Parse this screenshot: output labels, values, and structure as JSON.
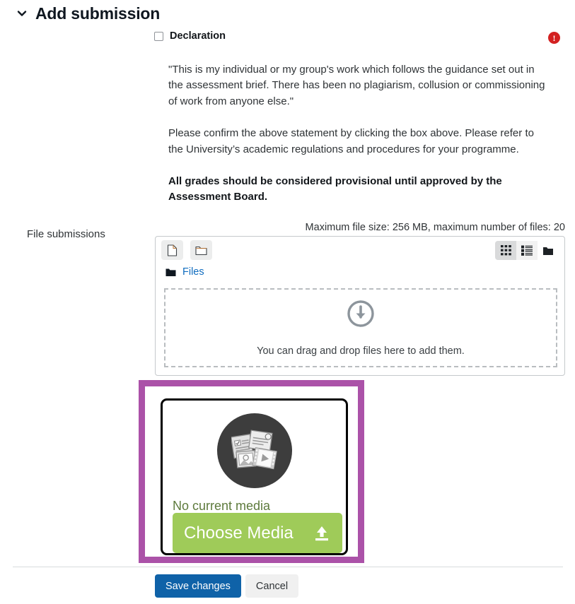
{
  "section": {
    "title": "Add submission",
    "toggle_icon": "chevron-down-icon"
  },
  "declaration": {
    "label": "Declaration",
    "checked": false,
    "required_icon": "required-error-icon",
    "required_glyph": "!",
    "paragraphs": [
      "\"This is my individual or my group's work which follows the guidance set out in the assessment brief. There has been no plagiarism, collusion or commissioning of work from anyone else.\"",
      "Please confirm the above statement by clicking the box above. Please refer to the University’s academic regulations and procedures for your programme.",
      "All grades should be considered provisional until approved by the Assessment Board."
    ]
  },
  "file_submissions": {
    "label": "File submissions",
    "max_note": "Maximum file size: 256 MB, maximum number of files: 20",
    "toolbar": {
      "add_file_icon": "file-add-icon",
      "create_folder_icon": "folder-add-icon",
      "views": [
        {
          "icon": "grid-view-icon",
          "active": true
        },
        {
          "icon": "list-view-icon",
          "active": false
        },
        {
          "icon": "tree-view-icon",
          "active": false
        }
      ]
    },
    "breadcrumb": {
      "icon": "folder-icon",
      "label": "Files"
    },
    "dropzone": {
      "icon": "download-arrow-icon",
      "text": "You can drag and drop files here to add them."
    }
  },
  "media_widget": {
    "highlight_color": "#ab52a8",
    "thumbnail_icon": "media-collage-icon",
    "status_text": "No current media",
    "button_label": "Choose Media",
    "button_icon": "upload-icon",
    "button_color": "#9fcb59"
  },
  "footer": {
    "save_label": "Save changes",
    "cancel_label": "Cancel",
    "primary_color": "#0f62a8"
  }
}
